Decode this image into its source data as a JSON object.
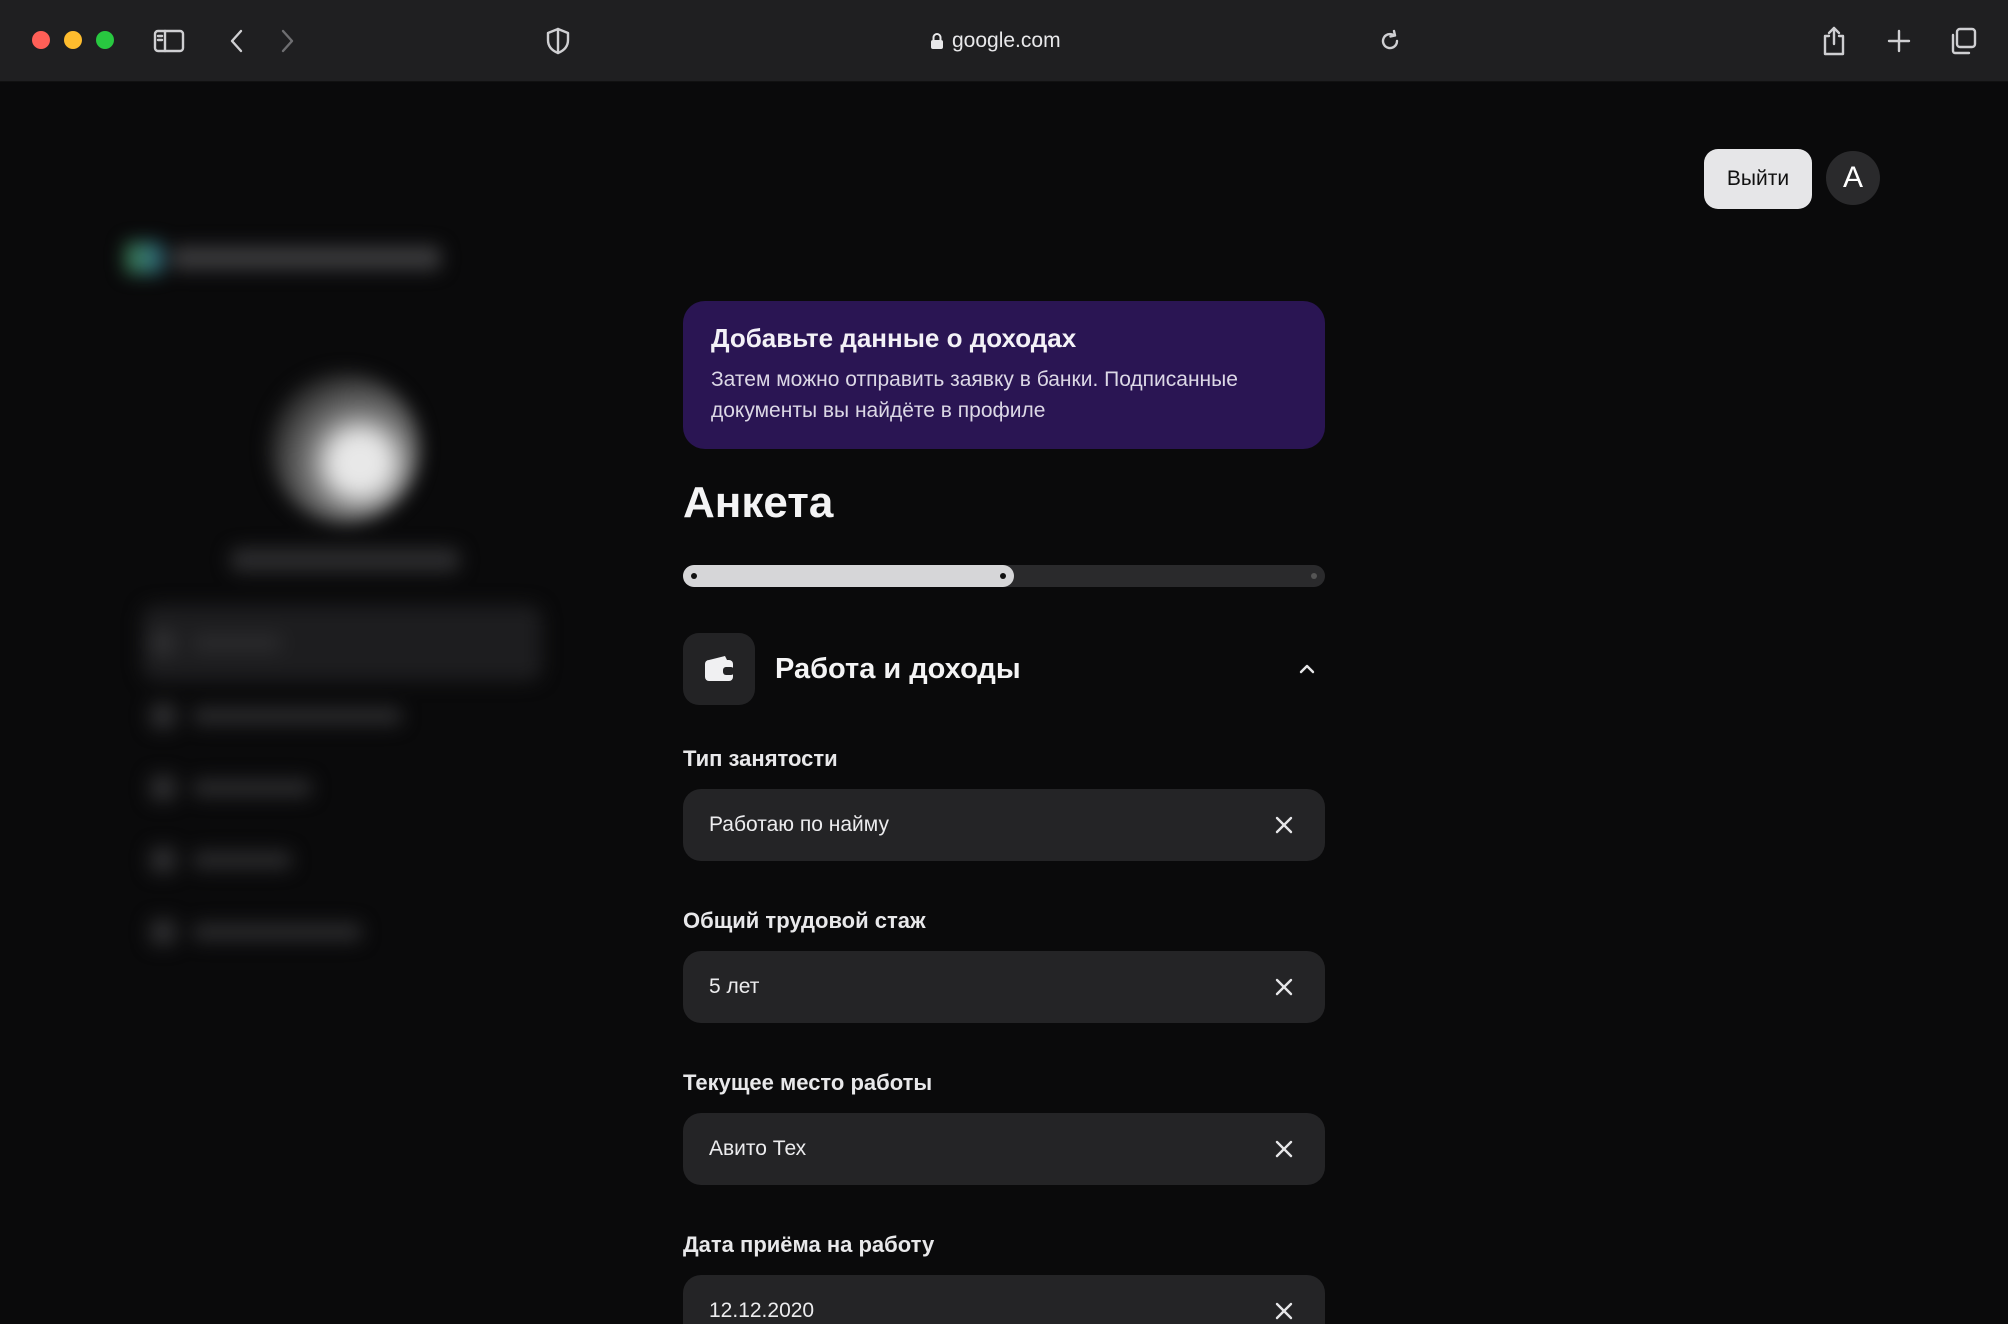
{
  "browser": {
    "url": "google.com"
  },
  "header": {
    "logout_label": "Выйти",
    "avatar_letter": "А"
  },
  "banner": {
    "title": "Добавьте данные о доходах",
    "text": "Затем можно отправить заявку в банки. Подписанные документы вы найдёте в профиле"
  },
  "form": {
    "title": "Анкета",
    "progress": 0.5,
    "section_title": "Работа и доходы",
    "fields": [
      {
        "label": "Тип занятости",
        "value": "Работаю по найму"
      },
      {
        "label": "Общий трудовой стаж",
        "value": "5 лет"
      },
      {
        "label": "Текущее место работы",
        "value": "Авито Тех"
      },
      {
        "label": "Дата приёма на работу",
        "value": "12.12.2020"
      }
    ]
  },
  "colors": {
    "page_bg": "#0a0a0b",
    "banner_bg": "#2a1553",
    "field_bg": "#242426",
    "progress_fill": "#d6d6d8"
  },
  "icons": {
    "section": "wallet-icon",
    "collapse": "chevron-up-icon",
    "clear": "close-icon"
  }
}
